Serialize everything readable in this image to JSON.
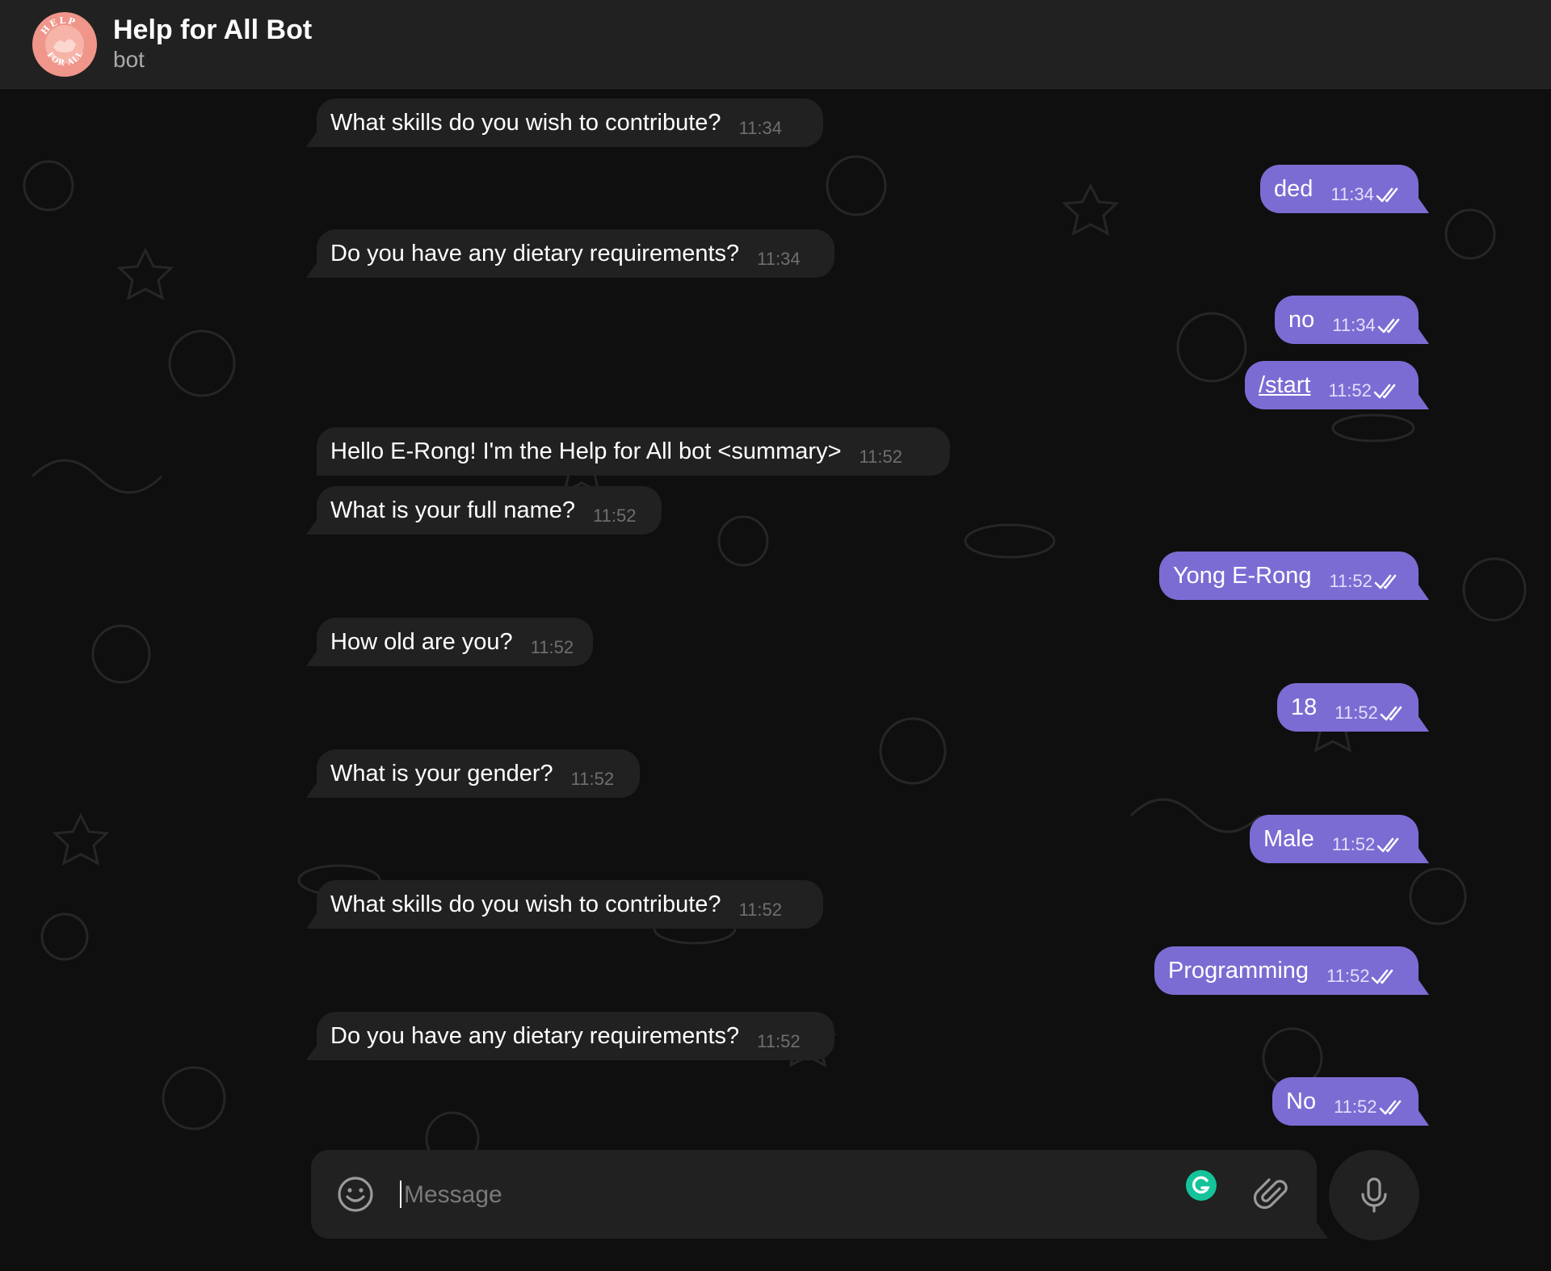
{
  "header": {
    "title": "Help for All Bot",
    "subtitle": "bot",
    "avatar_text_top": "HELP",
    "avatar_text_bottom": "FOR ALL"
  },
  "messages": [
    {
      "dir": "in",
      "text": "What skills do you wish to contribute?",
      "time": "11:34"
    },
    {
      "dir": "out",
      "text": "ded",
      "time": "11:34",
      "status": "read"
    },
    {
      "dir": "in",
      "text": "Do you have any dietary requirements?",
      "time": "11:34"
    },
    {
      "dir": "out",
      "text": "no",
      "time": "11:34",
      "status": "read"
    },
    {
      "dir": "out",
      "text": "/start",
      "time": "11:52",
      "status": "read",
      "is_command": true
    },
    {
      "dir": "in",
      "text": "Hello E-Rong! I'm the Help for All bot <summary>",
      "time": "11:52"
    },
    {
      "dir": "in",
      "text": "What is your full name?",
      "time": "11:52"
    },
    {
      "dir": "out",
      "text": "Yong E-Rong",
      "time": "11:52",
      "status": "read"
    },
    {
      "dir": "in",
      "text": "How old are you?",
      "time": "11:52"
    },
    {
      "dir": "out",
      "text": "18",
      "time": "11:52",
      "status": "read"
    },
    {
      "dir": "in",
      "text": "What is your gender?",
      "time": "11:52"
    },
    {
      "dir": "out",
      "text": "Male",
      "time": "11:52",
      "status": "read"
    },
    {
      "dir": "in",
      "text": "What skills do you wish to contribute?",
      "time": "11:52"
    },
    {
      "dir": "out",
      "text": "Programming",
      "time": "11:52",
      "status": "read"
    },
    {
      "dir": "in",
      "text": "Do you have any dietary requirements?",
      "time": "11:52"
    },
    {
      "dir": "out",
      "text": "No",
      "time": "11:52",
      "status": "read"
    }
  ],
  "composer": {
    "placeholder": "Message",
    "value": "",
    "icons": [
      "smile-icon",
      "grammarly-icon",
      "paperclip-icon",
      "microphone-icon"
    ]
  },
  "colors": {
    "background": "#0f0f0f",
    "header": "#212121",
    "incoming_bubble": "#212121",
    "outgoing_bubble": "#7b6cd3",
    "grammarly": "#15c39a",
    "avatar": "#f0958a"
  }
}
